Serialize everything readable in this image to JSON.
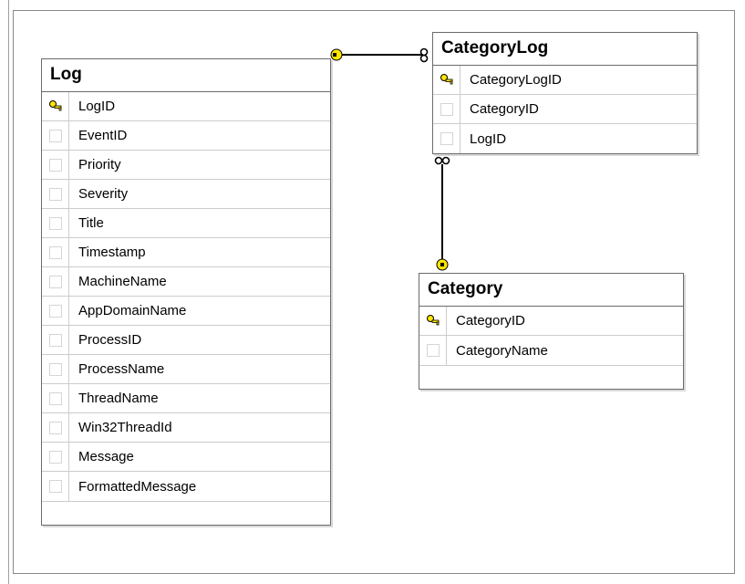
{
  "tables": {
    "log": {
      "title": "Log",
      "columns": [
        {
          "name": "LogID",
          "pk": true
        },
        {
          "name": "EventID",
          "pk": false
        },
        {
          "name": "Priority",
          "pk": false
        },
        {
          "name": "Severity",
          "pk": false
        },
        {
          "name": "Title",
          "pk": false
        },
        {
          "name": "Timestamp",
          "pk": false
        },
        {
          "name": "MachineName",
          "pk": false
        },
        {
          "name": "AppDomainName",
          "pk": false
        },
        {
          "name": "ProcessID",
          "pk": false
        },
        {
          "name": "ProcessName",
          "pk": false
        },
        {
          "name": "ThreadName",
          "pk": false
        },
        {
          "name": "Win32ThreadId",
          "pk": false
        },
        {
          "name": "Message",
          "pk": false
        },
        {
          "name": "FormattedMessage",
          "pk": false
        }
      ]
    },
    "categorylog": {
      "title": "CategoryLog",
      "columns": [
        {
          "name": "CategoryLogID",
          "pk": true
        },
        {
          "name": "CategoryID",
          "pk": false
        },
        {
          "name": "LogID",
          "pk": false
        }
      ]
    },
    "category": {
      "title": "Category",
      "columns": [
        {
          "name": "CategoryID",
          "pk": true
        },
        {
          "name": "CategoryName",
          "pk": false
        }
      ]
    }
  },
  "relationships": [
    {
      "from": "Log.LogID",
      "to": "CategoryLog.LogID",
      "type": "one-to-many"
    },
    {
      "from": "Category.CategoryID",
      "to": "CategoryLog.CategoryID",
      "type": "one-to-many"
    }
  ]
}
